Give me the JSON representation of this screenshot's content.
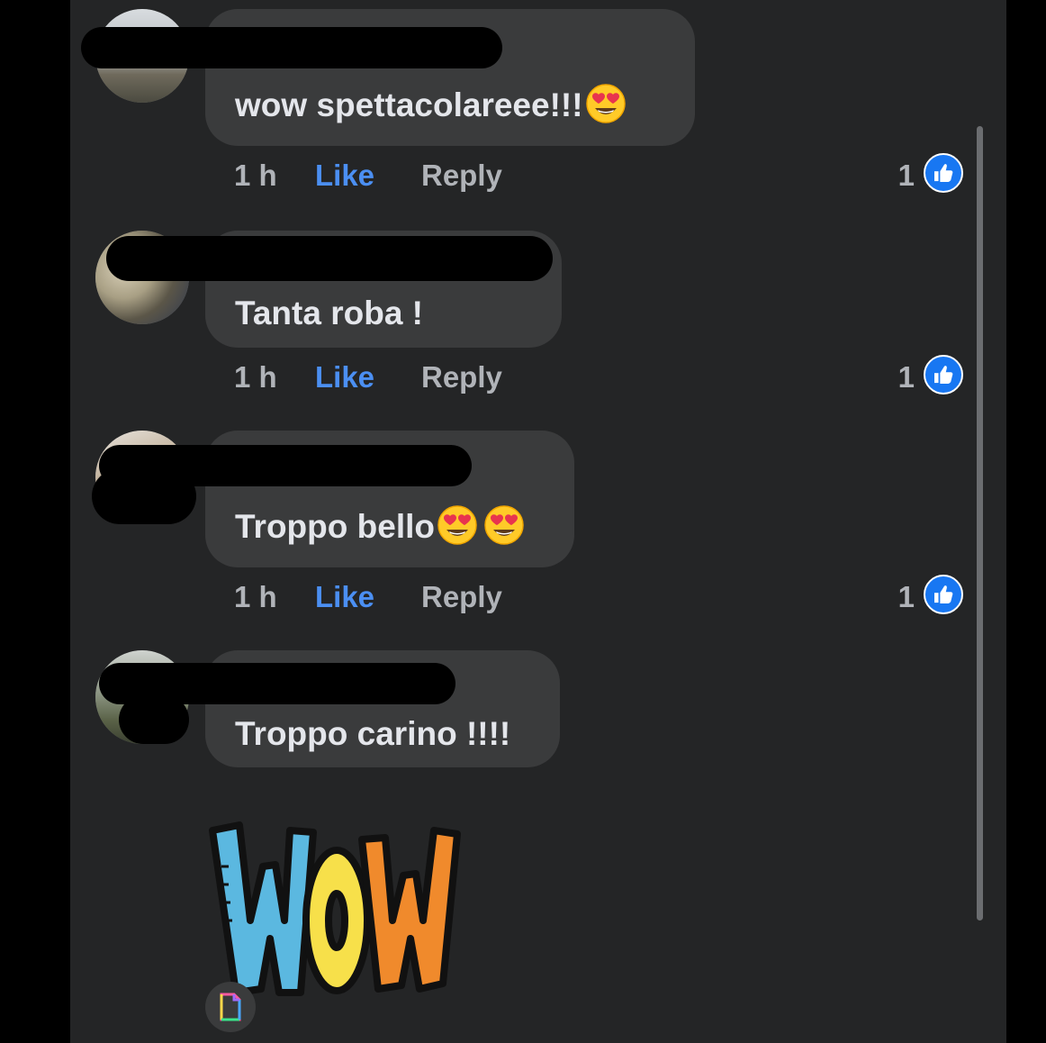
{
  "comments": [
    {
      "text": "wow spettacolareee!!!",
      "emoji_count": 1,
      "time": "1 h",
      "like_label": "Like",
      "reply_label": "Reply",
      "reaction_count": "1",
      "reaction_icon": "thumbs-up-icon"
    },
    {
      "text": "Tanta roba !",
      "emoji_count": 0,
      "time": "1 h",
      "like_label": "Like",
      "reply_label": "Reply",
      "reaction_count": "1",
      "reaction_icon": "thumbs-up-icon"
    },
    {
      "text": "Troppo bello",
      "emoji_count": 2,
      "time": "1 h",
      "like_label": "Like",
      "reply_label": "Reply",
      "reaction_count": "1",
      "reaction_icon": "thumbs-up-icon"
    },
    {
      "text": "Troppo carino !!!!",
      "emoji_count": 0
    }
  ],
  "sticker": {
    "text": "WOW",
    "badge_icon": "gif-icon"
  },
  "colors": {
    "background": "#242526",
    "bubble": "#3a3b3c",
    "like_blue": "#4b8ff2",
    "reaction_blue": "#1877f2",
    "secondary_text": "#b0b3b8"
  }
}
